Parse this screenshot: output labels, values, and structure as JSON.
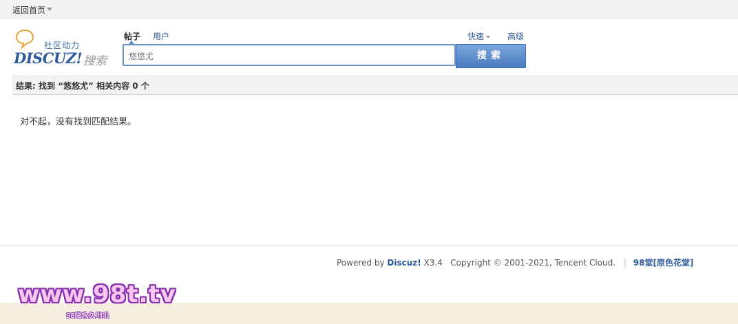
{
  "topbar": {
    "home_label": "返回首页"
  },
  "logo": {
    "slogan": "社区动力",
    "brand": "DISCUZ!",
    "search_word": "搜索"
  },
  "search": {
    "tabs": [
      {
        "label": "帖子",
        "active": true
      },
      {
        "label": "用户",
        "active": false
      }
    ],
    "quick_label": "快速",
    "advanced_label": "高级",
    "query": "悠悠尤",
    "button_label": "搜索"
  },
  "results": {
    "summary": "结果: 找到 “悠悠尤” 相关内容 0 个",
    "empty_message": "对不起，没有找到匹配结果。"
  },
  "footer": {
    "powered_prefix": "Powered by ",
    "powered_brand": "Discuz!",
    "version": " X3.4",
    "copyright": "Copyright © 2001-2021, Tencent Cloud.",
    "separator": "|",
    "site_link": "98堂[原色花堂]"
  },
  "watermark": {
    "main": "www.98t.tv",
    "sub": "98堂永久地址"
  },
  "colors": {
    "link": "#2d5a9b",
    "button": "#4a7cc0",
    "bar": "#f2f2f2"
  }
}
